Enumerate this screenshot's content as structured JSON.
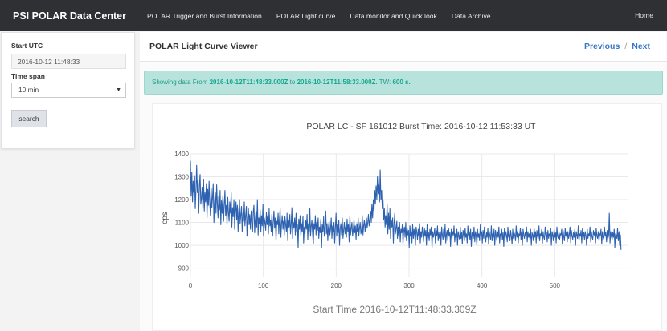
{
  "navbar": {
    "brand": "PSI POLAR Data Center",
    "links": [
      "POLAR Trigger and Burst Information",
      "POLAR Light curve",
      "Data monitor and Quick look",
      "Data Archive"
    ],
    "home": "Home"
  },
  "sidebar": {
    "start_label": "Start UTC",
    "start_value": "2016-10-12 11:48:33",
    "timespan_label": "Time span",
    "timespan_value": "10 min",
    "search_label": "search"
  },
  "header": {
    "title": "POLAR Light Curve Viewer",
    "previous": "Previous",
    "separator": "/",
    "next": "Next"
  },
  "alert": {
    "prefix": "Showing data From ",
    "from": "2016-10-12T11:48:33.000Z",
    "middle": " to ",
    "to": "2016-10-12T11:58:33.000Z.",
    "tw_label": " TW: ",
    "tw_value": "600 s."
  },
  "colors": {
    "navbar": "#2f3033",
    "accent": "#3a78c6",
    "alert_bg": "#b8e3dc",
    "alert_text": "#1f9c8a",
    "line": "#2e62b0"
  },
  "chart_data": {
    "type": "line",
    "title": "POLAR LC - SF 161012  Burst Time: 2016-10-12 11:53:33 UT",
    "xlabel": "Start Time 2016-10-12T11:48:33.309Z",
    "ylabel": "cps",
    "xlim": [
      0,
      600
    ],
    "ylim": [
      860,
      1400
    ],
    "x_ticks": [
      0,
      100,
      200,
      300,
      400,
      500
    ],
    "y_ticks": [
      900,
      1000,
      1100,
      1200,
      1300,
      1400
    ],
    "grid": true,
    "series": [
      {
        "values": [
          1370,
          1215,
          1320,
          1190,
          1280,
          1230,
          1305,
          1160,
          1245,
          1350,
          1230,
          1285,
          1140,
          1265,
          1310,
          1180,
          1205,
          1255,
          1160,
          1290,
          1150,
          1230,
          1190,
          1270,
          1120,
          1245,
          1175,
          1280,
          1190,
          1130,
          1250,
          1165,
          1210,
          1270,
          1100,
          1190,
          1230,
          1140,
          1265,
          1180,
          1120,
          1215,
          1155,
          1240,
          1090,
          1195,
          1140,
          1220,
          1105,
          1180,
          1240,
          1130,
          1175,
          1090,
          1210,
          1150,
          1105,
          1190,
          1140,
          1230,
          1080,
          1165,
          1125,
          1200,
          1070,
          1150,
          1190,
          1110,
          1175,
          1060,
          1145,
          1200,
          1095,
          1135,
          1170,
          1060,
          1140,
          1105,
          1190,
          1085,
          1130,
          1170,
          1040,
          1120,
          1160,
          1090,
          1135,
          1070,
          1150,
          1100,
          1060,
          1145,
          1175,
          1055,
          1110,
          1150,
          1080,
          1200,
          1045,
          1120,
          1095,
          1155,
          1060,
          1130,
          1085,
          1180,
          1040,
          1120,
          1100,
          1065,
          1145,
          1090,
          1130,
          1050,
          1160,
          1085,
          1110,
          1060,
          1135,
          1040,
          1100,
          1150,
          1075,
          1120,
          1020,
          1105,
          1090,
          1140,
          1050,
          1115,
          1160,
          1035,
          1095,
          1130,
          1070,
          1105,
          1045,
          1125,
          1090,
          1060,
          1140,
          1020,
          1110,
          1080,
          1135,
          1050,
          1095,
          1165,
          1030,
          1100,
          1075,
          1120,
          1045,
          1140,
          1060,
          1090,
          990,
          1115,
          1070,
          1130,
          1040,
          1095,
          1060,
          1125,
          1010,
          1080,
          1050,
          1110,
          1070,
          1135,
          1025,
          1095,
          1060,
          1160,
          1040,
          1085,
          1110,
          1050,
          1005,
          1095,
          1070,
          1130,
          1045,
          1100,
          1065,
          1120,
          1030,
          1080,
          1055,
          1115,
          990,
          1090,
          1060,
          1125,
          1040,
          1075,
          1150,
          1050,
          1095,
          1020,
          1080,
          1105,
          1045,
          1070,
          1120,
          1030,
          1085,
          1060,
          1100,
          1010,
          1075,
          1140,
          1040,
          1090,
          1055,
          1110,
          1000,
          1070,
          1095,
          1045,
          1120,
          1030,
          1065,
          1100,
          1050,
          1080,
          1035,
          1115,
          1060,
          1090,
          1015,
          1130,
          1045,
          1075,
          1100,
          1040,
          1070,
          1110,
          1055,
          1085,
          1025,
          1095,
          1060,
          1120,
          1040,
          1075,
          1100,
          1050,
          1065,
          1130,
          1045,
          1085,
          1110,
          1060,
          1090,
          1120,
          1075,
          1100,
          1135,
          1085,
          1110,
          1150,
          1100,
          1180,
          1120,
          1200,
          1150,
          1240,
          1180,
          1260,
          1200,
          1300,
          1225,
          1270,
          1190,
          1330,
          1200,
          1240,
          1160,
          1200,
          1110,
          1160,
          1080,
          1130,
          1090,
          1180,
          1050,
          1140,
          1070,
          1160,
          1030,
          1110,
          1080,
          1120,
          1010,
          1090,
          1140,
          1050,
          1075,
          1105,
          1030,
          1080,
          1040,
          1100,
          1015,
          1070,
          1055,
          1090,
          1005,
          1060,
          1080,
          1035,
          1100,
          1020,
          1075,
          1045,
          1065,
          990,
          1085,
          1040,
          1060,
          1010,
          1090,
          1030,
          1070,
          1045,
          1000,
          1080,
          1055,
          1025,
          1070,
          1040,
          1095,
          1010,
          1060,
          1035,
          1080,
          1050,
          1015,
          1075,
          1040,
          1065,
          1000,
          1090,
          1030,
          1055,
          1020,
          1070,
          1045,
          1080,
          990,
          1060,
          1035,
          1050,
          1075,
          1010,
          1065,
          1040,
          1085,
          1020,
          1055,
          1030,
          1060,
          1000,
          1080,
          1045,
          1025,
          1070,
          1035,
          1090,
          1010,
          1050,
          1065,
          1020,
          1075,
          1040,
          1055,
          995,
          1070,
          1030,
          1060,
          1045,
          1085,
          1015,
          1050,
          1035,
          1070,
          1000,
          1060,
          1040,
          1025,
          1080,
          1030,
          1055,
          1005,
          1065,
          1045,
          1020,
          1075,
          1035,
          1050,
          1010,
          1085,
          1040,
          1060,
          1025,
          1070,
          995,
          1055,
          1040,
          1030,
          1080,
          1015,
          1060,
          1045,
          1000,
          1070,
          1035,
          1050,
          1020,
          1090,
          1040,
          1060,
          1010,
          1065,
          1030,
          1080,
          1045,
          1015,
          1055,
          1035,
          1075,
          1005,
          1060,
          1040,
          1025,
          1085,
          1020,
          1050,
          1035,
          1070,
          1000,
          1065,
          1045,
          1020,
          1060,
          1035,
          1080,
          1010,
          1050,
          1040,
          1070,
          1025,
          1055,
          995,
          1075,
          1030,
          1060,
          1045,
          1015,
          1080,
          1035,
          1050,
          1020,
          1065,
          1040,
          1005,
          1070,
          1030,
          1055,
          1045,
          1020,
          1085,
          1035,
          1060,
          1010,
          1050,
          1040,
          1075,
          1025,
          1060,
          1000,
          1070,
          1045,
          1030,
          1055,
          1040,
          1080,
          1015,
          1060,
          1035,
          1050,
          1025,
          1070,
          1000,
          1055,
          1045,
          1020,
          1075,
          1035,
          1060,
          1010,
          1065,
          1040,
          1030,
          1085,
          1020,
          1050,
          1040,
          1070,
          1005,
          1060,
          1035,
          1025,
          1080,
          1045,
          1055,
          1015,
          1065,
          1030,
          1050,
          1040,
          1075,
          1000,
          1060,
          1045,
          1020,
          1070,
          1035,
          1055,
          1010,
          1080,
          1040,
          1030,
          1060,
          1025,
          1050,
          1045,
          1070,
          1005,
          1065,
          1035,
          1020,
          1075,
          1040,
          1055,
          1015,
          1060,
          1030,
          1045,
          1080,
          1010,
          1065,
          1040,
          1025,
          1055,
          1035,
          1070,
          1000,
          1060,
          1045,
          1030,
          1085,
          1020,
          1050,
          1040,
          1065,
          1010,
          1075,
          1035,
          1055,
          1025,
          1060,
          1045,
          1000,
          1070,
          1030,
          1050,
          1040,
          1080,
          1015,
          1060,
          1035,
          1025,
          1065,
          1045,
          1055,
          1010,
          1075,
          1040,
          1030,
          1060,
          1020,
          1050,
          1045,
          1070,
          1005,
          1060,
          1035,
          1025,
          1080,
          1040,
          1055,
          1015,
          1065,
          1030,
          1045,
          1140,
          1010,
          1060,
          1040,
          1025,
          1055,
          1035,
          1070,
          990,
          1050,
          1045,
          1030,
          1075,
          1020,
          1060,
          1000,
          1045,
          980
        ]
      }
    ]
  }
}
